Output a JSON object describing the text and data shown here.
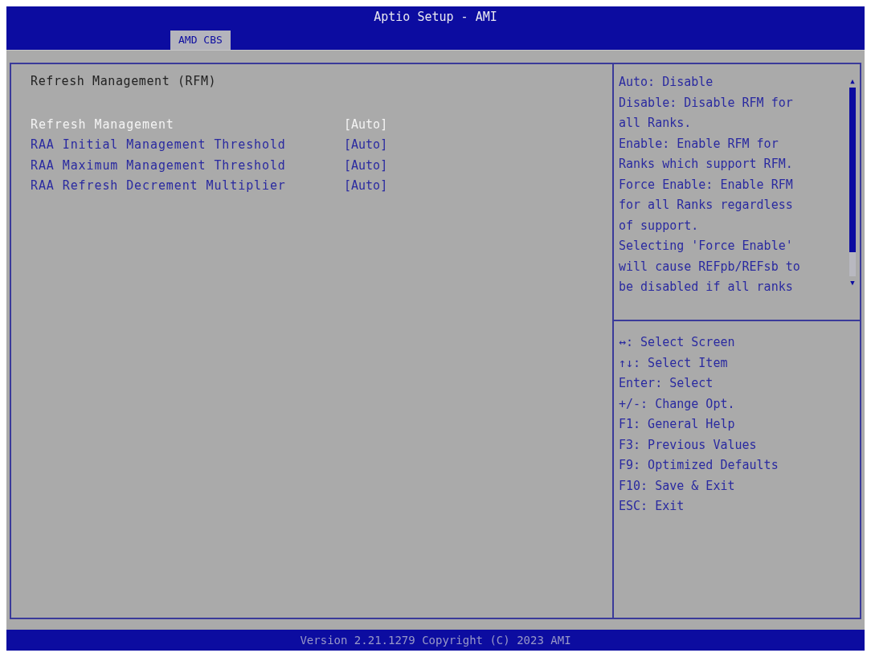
{
  "window": {
    "title": "Aptio Setup - AMI"
  },
  "tabs": [
    {
      "label": "AMD CBS",
      "selected": true
    }
  ],
  "page": {
    "heading": "Refresh Management (RFM)",
    "items": [
      {
        "label": "Refresh Management",
        "value": "[Auto]",
        "selected": true
      },
      {
        "label": "RAA Initial Management Threshold",
        "value": "[Auto]",
        "selected": false
      },
      {
        "label": "RAA Maximum Management Threshold",
        "value": "[Auto]",
        "selected": false
      },
      {
        "label": "RAA Refresh Decrement Multiplier",
        "value": "[Auto]",
        "selected": false
      }
    ]
  },
  "help": {
    "lines": [
      "Auto: Disable",
      "Disable: Disable RFM for",
      "all Ranks.",
      "Enable: Enable RFM for",
      "Ranks which support RFM.",
      "Force Enable: Enable RFM",
      "for all Ranks regardless",
      "of support.",
      "Selecting 'Force Enable'",
      "will cause REFpb/REFsb to",
      "be disabled if all ranks"
    ],
    "scroll_up": "▲",
    "scroll_down": "▼"
  },
  "keys": [
    "↔: Select Screen",
    "↑↓: Select Item",
    "Enter: Select",
    "+/-: Change Opt.",
    "F1: General Help",
    "F3: Previous Values",
    "F9: Optimized Defaults",
    "F10: Save & Exit",
    "ESC: Exit"
  ],
  "status_bar": "Version 2.21.1279 Copyright (C) 2023 AMI"
}
